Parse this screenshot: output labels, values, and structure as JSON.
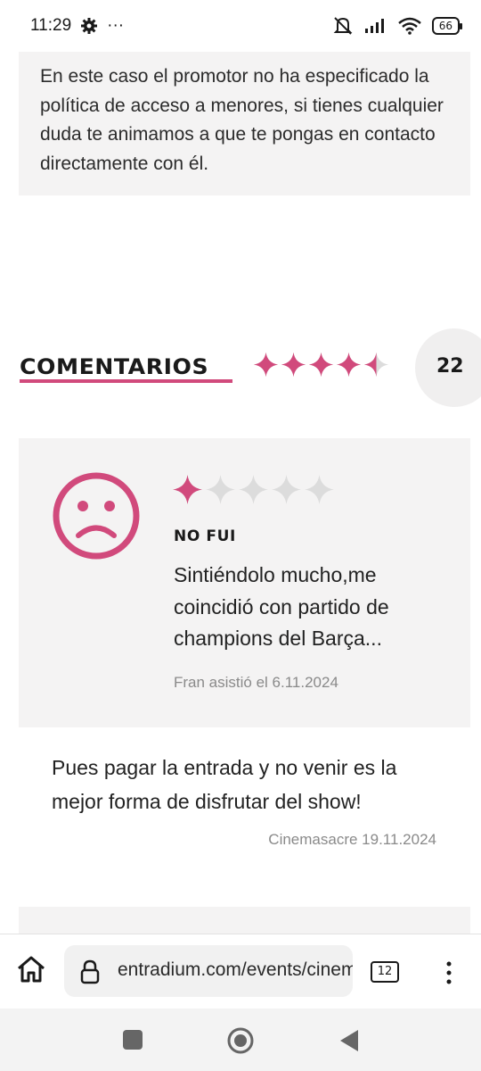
{
  "status_bar": {
    "time": "11:29",
    "dots": "···",
    "battery": "66"
  },
  "info": {
    "text": "En este caso el promotor no ha especificado la política de acceso a menores, si tienes cualquier duda te animamos a que te pongas en contacto directamente con él."
  },
  "comments": {
    "title": "COMENTARIOS",
    "average_rating": 4.5,
    "max_rating": 5,
    "count": "22",
    "accent_color": "#d14a7c"
  },
  "review": {
    "rating": 1,
    "max_rating": 5,
    "status": "NO FUI",
    "text": "Sintiéndolo mucho,me coincidió con partido de champions del Barça...",
    "meta": "Fran asistió el 6.11.2024",
    "face_icon": "sad-face-icon"
  },
  "reply": {
    "text": "Pues pagar la entrada y no venir es la mejor forma de disfrutar del show!",
    "meta": "Cinemasacre 19.11.2024"
  },
  "browser": {
    "url": "entradium.com/events/cinemasacre",
    "tab_count": "12"
  }
}
